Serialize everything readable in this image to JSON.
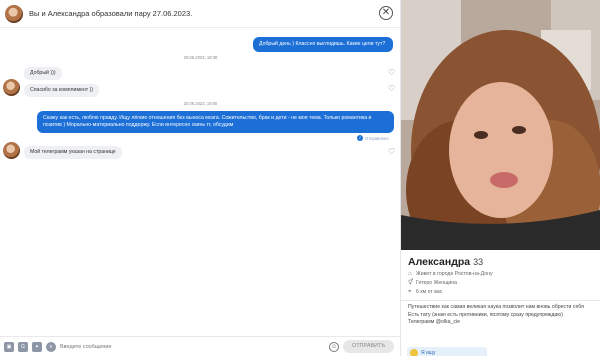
{
  "header": {
    "title": "Вы и Александра образовали пару 27.06.2023.",
    "close_glyph": "✕"
  },
  "messages": [
    {
      "type": "out",
      "text": "Добрый день ) Классно выглядишь. Какие цели тут?"
    },
    {
      "type": "date",
      "text": "20.06.2023, 18:30"
    },
    {
      "type": "in",
      "text": "Добрый )))"
    },
    {
      "type": "in",
      "text": "Спасибо за комплимент ))"
    },
    {
      "type": "date",
      "text": "20.06.2023, 19:00"
    },
    {
      "type": "out",
      "text": "Скажу как есть, люблю правду. Ищу лёгкие отношения без выноса мозга. Сожительство, брак и дети - не моя тема. Только романтика и позитив ) Морально-материально поддержу. Если интересно скинь тг, обсудим"
    },
    {
      "type": "status",
      "text": "Отправлено"
    },
    {
      "type": "in",
      "text": "Мой телеграмм указан на странице"
    }
  ],
  "input": {
    "placeholder": "Введите сообщение",
    "send_label": "ОТПРАВИТЬ"
  },
  "toolbar_icons": [
    "image-icon",
    "gif-icon",
    "sticker-icon",
    "list-icon"
  ],
  "profile": {
    "name": "Александра",
    "age": "33",
    "city": "Живет в городе Ростов-на-Дону",
    "orientation": "Гетеро Женщина",
    "distance": "6 км от вас",
    "about_line1": "Путешествие как самая великая наука позволит нам вновь обрести себя",
    "about_line2": "Есть тату (знаю есть противники, поэтому сразу предупреждаю)",
    "about_line3": "Телеграмм @olka_cie",
    "like_label": "Я ищу"
  },
  "colors": {
    "accent": "#1b6fd6",
    "incoming_bubble": "#eef0f3"
  }
}
